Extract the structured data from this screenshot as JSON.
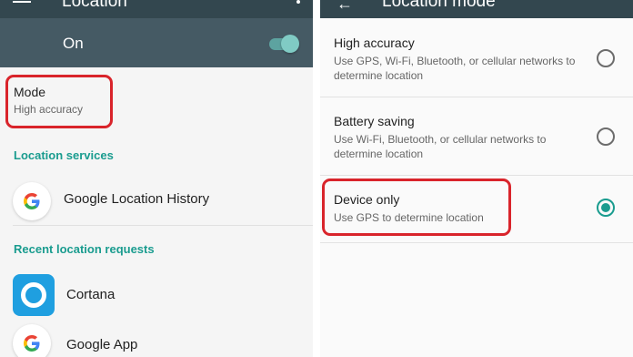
{
  "left": {
    "header": {
      "title": "Location",
      "menu_icon": "menu-icon",
      "more_icon": "more-vert-icon"
    },
    "master_switch": {
      "label": "On",
      "state": "on",
      "accent": "#80cbc4"
    },
    "mode": {
      "title": "Mode",
      "value": "High accuracy",
      "highlight_color": "#d9242b"
    },
    "sections": {
      "location_services": "Location services",
      "recent_requests": "Recent location requests"
    },
    "services": [
      {
        "label": "Google Location History",
        "icon": "google-icon"
      }
    ],
    "recent": [
      {
        "label": "Cortana",
        "icon": "cortana-icon"
      },
      {
        "label": "Google App",
        "icon": "google-icon"
      }
    ],
    "colors": {
      "appbar": "#33474f",
      "toggle_bar": "#455a64",
      "section": "#1a9c8f"
    }
  },
  "right": {
    "header": {
      "title": "Location mode",
      "back_icon": "arrow-back-icon"
    },
    "options": [
      {
        "title": "High accuracy",
        "desc": "Use GPS, Wi-Fi, Bluetooth, or cellular networks to determine location",
        "selected": false
      },
      {
        "title": "Battery saving",
        "desc": "Use Wi-Fi, Bluetooth, or cellular networks to determine location",
        "selected": false
      },
      {
        "title": "Device only",
        "desc": "Use GPS to determine location",
        "selected": true
      }
    ],
    "colors": {
      "radio_selected": "#1a9c8f"
    }
  }
}
